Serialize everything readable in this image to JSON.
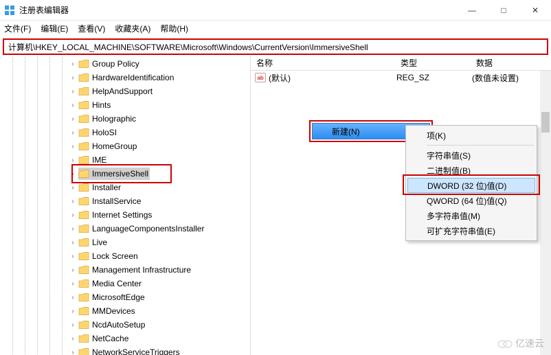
{
  "window": {
    "title": "注册表编辑器",
    "min": "—",
    "max": "□",
    "close": "✕"
  },
  "menu": {
    "file": "文件(F)",
    "edit": "编辑(E)",
    "view": "查看(V)",
    "fav": "收藏夹(A)",
    "help": "帮助(H)"
  },
  "address": "计算机\\HKEY_LOCAL_MACHINE\\SOFTWARE\\Microsoft\\Windows\\CurrentVersion\\ImmersiveShell",
  "tree": [
    {
      "label": "Group Policy"
    },
    {
      "label": "HardwareIdentification"
    },
    {
      "label": "HelpAndSupport"
    },
    {
      "label": "Hints"
    },
    {
      "label": "Holographic"
    },
    {
      "label": "HoloSI"
    },
    {
      "label": "HomeGroup"
    },
    {
      "label": "IME"
    },
    {
      "label": "ImmersiveShell",
      "selected": true
    },
    {
      "label": "Installer"
    },
    {
      "label": "InstallService"
    },
    {
      "label": "Internet Settings"
    },
    {
      "label": "LanguageComponentsInstaller"
    },
    {
      "label": "Live"
    },
    {
      "label": "Lock Screen"
    },
    {
      "label": "Management Infrastructure"
    },
    {
      "label": "Media Center"
    },
    {
      "label": "MicrosoftEdge"
    },
    {
      "label": "MMDevices"
    },
    {
      "label": "NcdAutoSetup"
    },
    {
      "label": "NetCache"
    },
    {
      "label": "NetworkServiceTriggers"
    }
  ],
  "list": {
    "columns": {
      "name": "名称",
      "type": "类型",
      "data": "数据"
    },
    "rows": [
      {
        "name": "(默认)",
        "type": "REG_SZ",
        "data": "(数值未设置)"
      }
    ]
  },
  "ctx1": {
    "new": "新建(N)"
  },
  "ctx2": {
    "key": "项(K)",
    "string": "字符串值(S)",
    "binary": "二进制值(B)",
    "dword": "DWORD (32 位)值(D)",
    "qword": "QWORD (64 位)值(Q)",
    "multi": "多字符串值(M)",
    "expand": "可扩充字符串值(E)"
  },
  "watermark": "亿速云"
}
